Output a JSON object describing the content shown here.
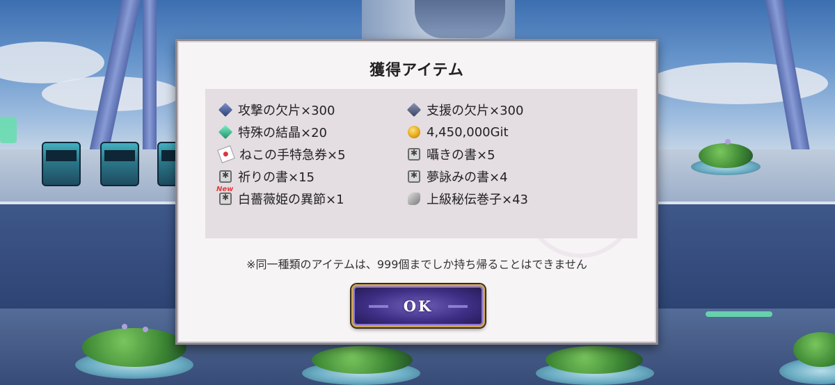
{
  "dialog": {
    "title": "獲得アイテム",
    "items_left": [
      {
        "label": "攻撃の欠片×300",
        "icon": "attack-shard-icon",
        "new": false
      },
      {
        "label": "特殊の結晶×20",
        "icon": "special-crystal-icon",
        "new": false
      },
      {
        "label": "ねこの手特急券×5",
        "icon": "cat-ticket-icon",
        "new": false
      },
      {
        "label": "祈りの書×15",
        "icon": "prayer-book-icon",
        "new": false
      },
      {
        "label": "白薔薇姫の異節×1",
        "icon": "white-rose-book-icon",
        "new": true
      }
    ],
    "items_right": [
      {
        "label": "支援の欠片×300",
        "icon": "support-shard-icon",
        "new": false
      },
      {
        "label": "4,450,000Git",
        "icon": "gold-coin-icon",
        "new": false
      },
      {
        "label": "囁きの書×5",
        "icon": "whisper-book-icon",
        "new": false
      },
      {
        "label": "夢詠みの書×4",
        "icon": "dream-book-icon",
        "new": false
      },
      {
        "label": "上級秘伝巻子×43",
        "icon": "secret-scroll-icon",
        "new": false
      }
    ],
    "new_badge": "New",
    "note": "※同一種類のアイテムは、999個までしか持ち帰ることはできません",
    "ok_label": "OK"
  },
  "colors": {
    "modal_bg": "#f7f4f6",
    "panel_bg": "#e4dde2",
    "ok_button": "#3f2f86",
    "ok_border": "#caa45a",
    "new_badge": "#e23a3a"
  }
}
